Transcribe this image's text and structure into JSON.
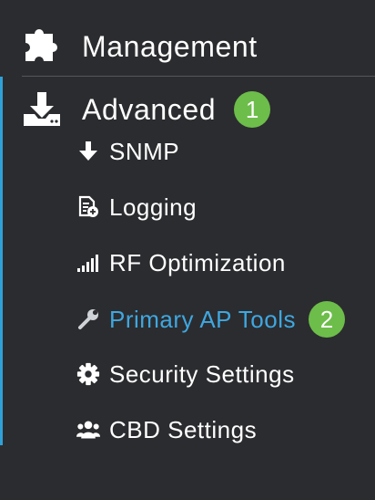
{
  "colors": {
    "background": "#2b2c2f",
    "text": "#ffffff",
    "active_text": "#3fa7e0",
    "accent_bar": "#2fa0d8",
    "badge": "#6dbd4a"
  },
  "menu": {
    "management": {
      "label": "Management",
      "icon": "puzzle-icon"
    },
    "advanced": {
      "label": "Advanced",
      "icon": "download-tray-icon",
      "badge": "1"
    },
    "items": [
      {
        "label": "SNMP",
        "icon": "arrow-down-icon"
      },
      {
        "label": "Logging",
        "icon": "document-icon"
      },
      {
        "label": "RF Optimization",
        "icon": "signal-bars-icon"
      },
      {
        "label": "Primary AP Tools",
        "icon": "wrench-icon",
        "badge": "2",
        "active": true
      },
      {
        "label": "Security Settings",
        "icon": "gear-icon"
      },
      {
        "label": "CBD Settings",
        "icon": "users-icon"
      }
    ]
  }
}
